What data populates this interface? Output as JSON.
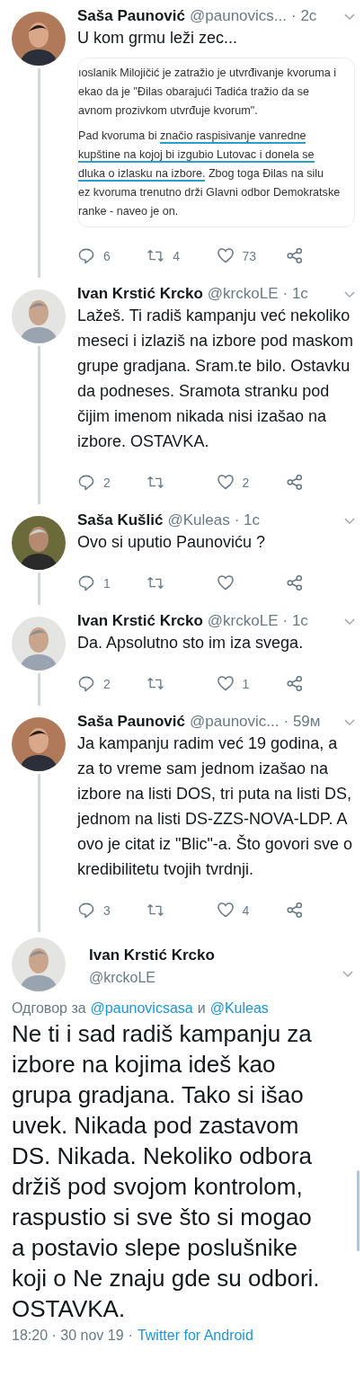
{
  "tweets": [
    {
      "kind": "reply",
      "name": "Saša Paunović",
      "handle": "@paunovics...",
      "time": "· 2c",
      "text": "U kom grmu leži zec...",
      "connected_below": true,
      "embed": {
        "paragraphs": [
          [
            {
              "text": "ıoslanik Milojičić je zatražio je utvrđivanje kvoruma i",
              "underlined": false
            }
          ],
          [
            {
              "text": "ekao da je \"Đilas obarajući Tadića tražio da se",
              "underlined": false
            }
          ],
          [
            {
              "text": "avnom prozivkom utvrđuje kvorum\".",
              "underlined": false
            }
          ],
          [
            {
              "text": "Pad kvoruma bi ",
              "underlined": false
            },
            {
              "text": "značio raspisivanje vanredne",
              "underlined": true
            }
          ],
          [
            {
              "text": "kupštine na kojoj bi izgubio Lutovac i donela se",
              "underlined": true
            }
          ],
          [
            {
              "text": "dluka o izlasku na izbore.",
              "underlined": true
            },
            {
              "text": " Zbog toga Đilas na silu",
              "underlined": false
            }
          ],
          [
            {
              "text": "ez kvoruma trenutno drži Glavni odbor Demokratske",
              "underlined": false
            }
          ],
          [
            {
              "text": "ranke - naveo je on.",
              "underlined": false
            }
          ]
        ]
      },
      "actions": {
        "replies": "6",
        "retweets": "4",
        "likes": "73"
      }
    },
    {
      "kind": "reply",
      "name": "Ivan Krstić Krcko",
      "handle": "@krckoLE",
      "time": "· 1c",
      "text": "Lažeš. Ti radiš kampanju već nekoliko meseci i izlaziš na izbore pod maskom grupe gradjana. Sram.te bilo. Ostavku da podneses. Sramota stranku pod čijim imenom nikada nisi izašao na izbore. OSTAVKA.",
      "connected_below": true,
      "actions": {
        "replies": "2",
        "likes": "2"
      }
    },
    {
      "kind": "reply",
      "name": "Saša Kušlić",
      "handle": "@Kuleas",
      "time": "· 1c",
      "text": "Ovo si uputio Paunoviću ?",
      "connected_below": true,
      "actions": {
        "replies": "1"
      }
    },
    {
      "kind": "reply",
      "name": "Ivan Krstić Krcko",
      "handle": "@krckoLE",
      "time": "· 1c",
      "text": "Da. Apsolutno sto im iza svega.",
      "connected_below": true,
      "actions": {
        "replies": "2",
        "likes": "1"
      }
    },
    {
      "kind": "reply",
      "name": "Saša Paunović",
      "handle": "@paunovic...",
      "time": "· 59м",
      "text": "Ja kampanju radim već 19 godina, a za to vreme sam jednom izašao na izbore na listi DOS, tri puta na listi DS, jednom na listi DS-ZZS-NOVA-LDP. A ovo je citat iz \"Blic\"-a. Što govori sve o kredibilitetu tvojih tvrdnji.",
      "connected_below": true,
      "actions": {
        "replies": "3",
        "likes": "4"
      }
    },
    {
      "kind": "focused",
      "name": "Ivan Krstić Krcko",
      "handle": "@krckoLE",
      "connected_below": false,
      "reply_to": {
        "prefix": "Одговор за",
        "first": "@paunovicsasa",
        "joiner": "и",
        "second": "@Kuleas"
      },
      "text": "Ne ti i sad radiš kampanju za izbore na kojima ideš kao grupa gradjana. Tako si išao uvek. Nikada pod zastavom DS. Nikada. Nekoliko odbora držiš pod svojom kontrolom, raspustio si sve što si mogao a postavio slepe poslušnike koji o Ne znaju gde su odbori. OSTAVKA.",
      "time": "18:20 · 30 nov 19",
      "separator": "·",
      "source": "Twitter for Android"
    }
  ]
}
